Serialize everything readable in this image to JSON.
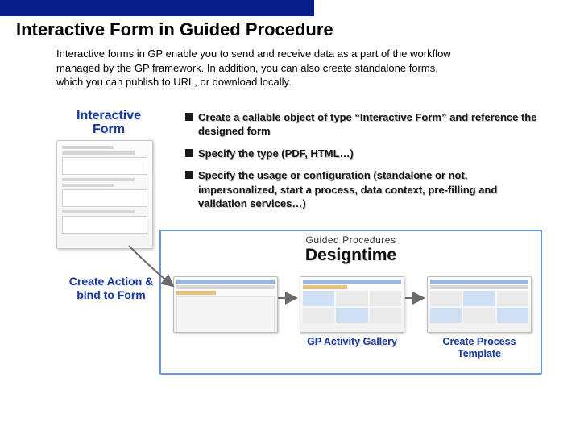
{
  "title": "Interactive Form in Guided Procedure",
  "intro": "Interactive forms in GP enable you to send and receive data as a part of the workflow managed by the GP framework. In addition, you can also create standalone forms, which you can publish to URL, or download locally.",
  "form": {
    "label_line1": "Interactive",
    "label_line2": "Form"
  },
  "bullets": [
    "Create a callable object of type “Interactive Form” and reference the designed form",
    "Specify the type (PDF, HTML…)",
    "Specify the usage or configuration (standalone or not, impersonalized, start a process, data context, pre-filling and validation services…)"
  ],
  "create_action": "Create Action & bind to Form",
  "flow": {
    "subtitle": "Guided Procedures",
    "title": "Designtime",
    "panels": {
      "p1": "",
      "p2": "GP Activity Gallery",
      "p3": "Create Process Template"
    }
  }
}
